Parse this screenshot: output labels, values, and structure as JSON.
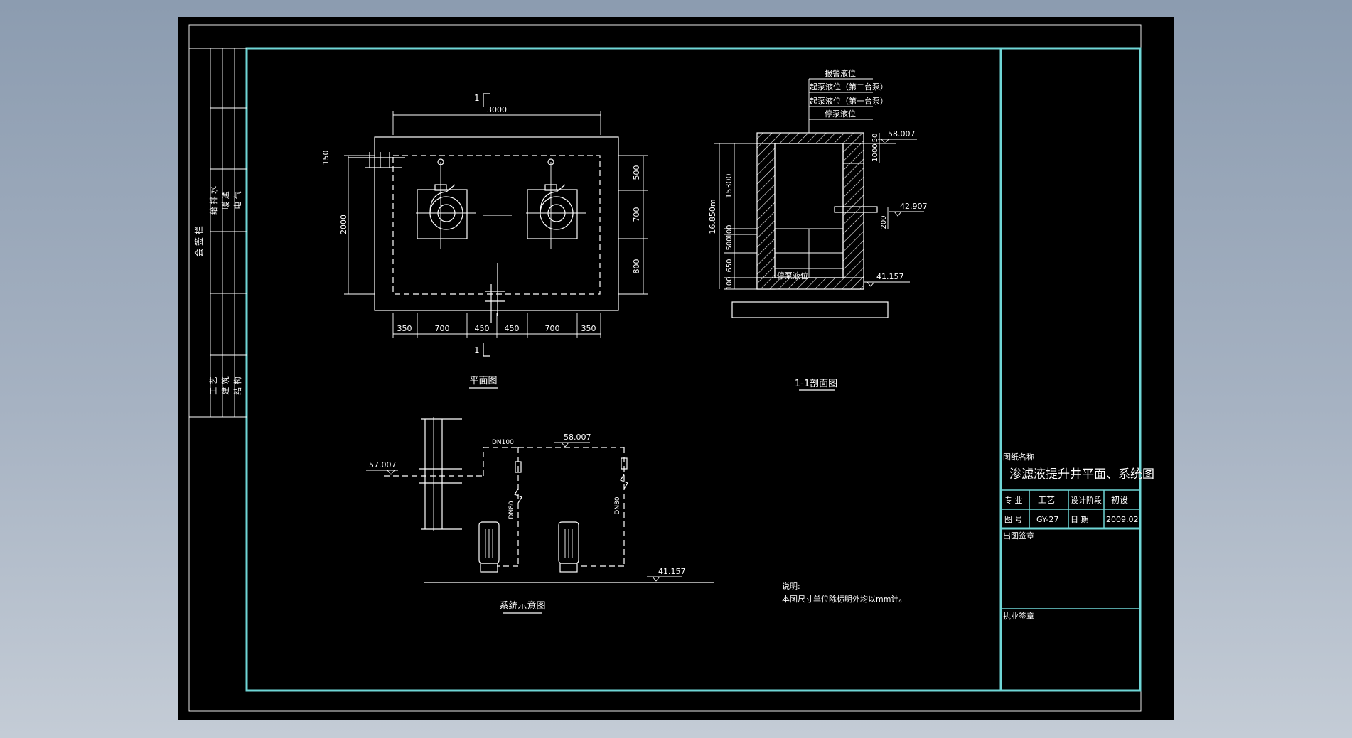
{
  "colors": {
    "background_gradient_top": "#8c9cb0",
    "background_gradient_bottom": "#c4ccd6",
    "drawing_bg": "#000000",
    "frame_line": "#6fd6d6",
    "linework": "#ffffff"
  },
  "left_strip": {
    "title": "会 签 栏",
    "disciplines_top": [
      "给 排 水",
      "暖 通",
      "电 气"
    ],
    "disciplines_bottom": [
      "工 艺",
      "建 筑",
      "结 构"
    ]
  },
  "plan": {
    "caption": "平面图",
    "section_mark": "1",
    "width_dim": "3000",
    "height_dim": "2000",
    "left_top_dim": "150",
    "right_dims": [
      "500",
      "700",
      "800"
    ],
    "bottom_dims": [
      "350",
      "700",
      "450",
      "450",
      "700",
      "350"
    ]
  },
  "section": {
    "caption": "1-1剖面图",
    "levels": [
      "报警液位",
      "起泵液位（第二台泵）",
      "起泵液位（第一台泵）",
      "停泵液位"
    ],
    "stop_level_label": "停泵液位",
    "elevations": {
      "top": "58.007",
      "pipe": "42.907",
      "bottom": "41.157",
      "left": "16.850m"
    },
    "dims_left": [
      "15300",
      "100",
      "500",
      "650",
      "100"
    ],
    "dims_right": [
      "50",
      "1000"
    ],
    "dim_pipe": "200"
  },
  "system": {
    "caption": "系统示意图",
    "elev_left": "57.007",
    "elev_top": "58.007",
    "elev_bottom": "41.157",
    "pipe_main": "DN100",
    "pipe_branch_left": "DN80",
    "pipe_branch_right": "DN80"
  },
  "notes": {
    "title": "说明:",
    "body": "本图尺寸单位除标明外均以mm计。"
  },
  "title_block": {
    "name_label": "图纸名称",
    "drawing_name": "渗滤液提升井平面、系统图",
    "discipline_label": "专 业",
    "discipline_value": "工艺",
    "stage_label": "设计阶段",
    "stage_value": "初设",
    "number_label": "图 号",
    "number_value": "GY-27",
    "date_label": "日  期",
    "date_value": "2009.02",
    "issue_sign_label": "出图签章",
    "license_sign_label": "执业签章"
  }
}
